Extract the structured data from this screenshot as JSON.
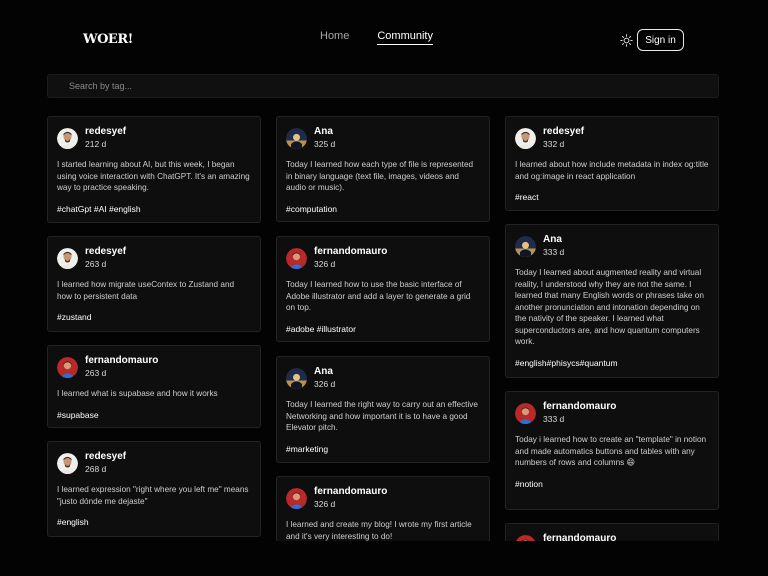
{
  "header": {
    "logo": "WOER!",
    "nav": [
      "Home",
      "Community"
    ],
    "active_nav": "Community",
    "signin_label": "Sign in",
    "theme_icon": "sun-icon"
  },
  "search": {
    "placeholder": "Search by tag..."
  },
  "colors": {
    "background": "#030303",
    "card": "#0e0e0e",
    "card_border": "#232323",
    "text": "#cfcfcf"
  },
  "posts": [
    {
      "user": "redesyef",
      "age": "212 d",
      "avatar": "redesyef-avatar",
      "text": "I started learning about AI, but this week, I began using voice interaction with ChatGPT. It's an amazing way to practice speaking.",
      "tags": "#chatGpt #AI #english"
    },
    {
      "user": "Ana",
      "age": "325 d",
      "avatar": "ana-avatar",
      "text": "Today I learned how each type of file is represented in binary language (text file, images, videos and audio or music).",
      "tags": "#computation"
    },
    {
      "user": "redesyef",
      "age": "332 d",
      "avatar": "redesyef-avatar",
      "text": "I learned about how include metadata in index og:title and og:image in react application",
      "tags": "#react"
    },
    {
      "user": "redesyef",
      "age": "263 d",
      "avatar": "redesyef-avatar",
      "text": "I learned how migrate useContex to Zustand and how to persistent data",
      "tags": "#zustand"
    },
    {
      "user": "fernandomauro",
      "age": "326 d",
      "avatar": "fernandomauro-avatar",
      "text": "Today I learned how to use the basic interface of Adobe illustrator and add a layer to generate a grid on top.",
      "tags": "#adobe #illustrator"
    },
    {
      "user": "Ana",
      "age": "333 d",
      "avatar": "ana-avatar",
      "text": "Today I learned about augmented reality and virtual reality, I understood why they are not the same. I learned that many English words or phrases take on another pronunciation and intonation depending on the nativity of the speaker. I learned what superconductors are, and how quantum computers work.",
      "tags": "#english#phisycs#quantum"
    },
    {
      "user": "fernandomauro",
      "age": "263 d",
      "avatar": "fernandomauro-avatar",
      "text": "I learned what is supabase and how it works",
      "tags": "#supabase"
    },
    {
      "user": "Ana",
      "age": "326 d",
      "avatar": "ana-avatar",
      "text": "Today I learned the right way to carry out an effective Networking and how important it is to have a good Elevator pitch.",
      "tags": "#marketing"
    },
    {
      "user": "fernandomauro",
      "age": "333 d",
      "avatar": "fernandomauro-avatar",
      "text": "Today i learned how to create an \"template\" in notion and made automatics buttons and tables with any numbers of rows and columns 😄",
      "tags": "#notion"
    },
    {
      "user": "redesyef",
      "age": "268 d",
      "avatar": "redesyef-avatar",
      "text": "I learned expression \"right where you left me\" means \"justo dónde me dejaste\"",
      "tags": "#english"
    },
    {
      "user": "fernandomauro",
      "age": "326 d",
      "avatar": "fernandomauro-avatar",
      "text": "I learned and create my blog! I wrote my first article and it's very interesting to do!",
      "tags": ""
    },
    {
      "user": "fernandomauro",
      "age": "",
      "avatar": "fernandomauro-avatar",
      "text": "",
      "tags": ""
    }
  ]
}
